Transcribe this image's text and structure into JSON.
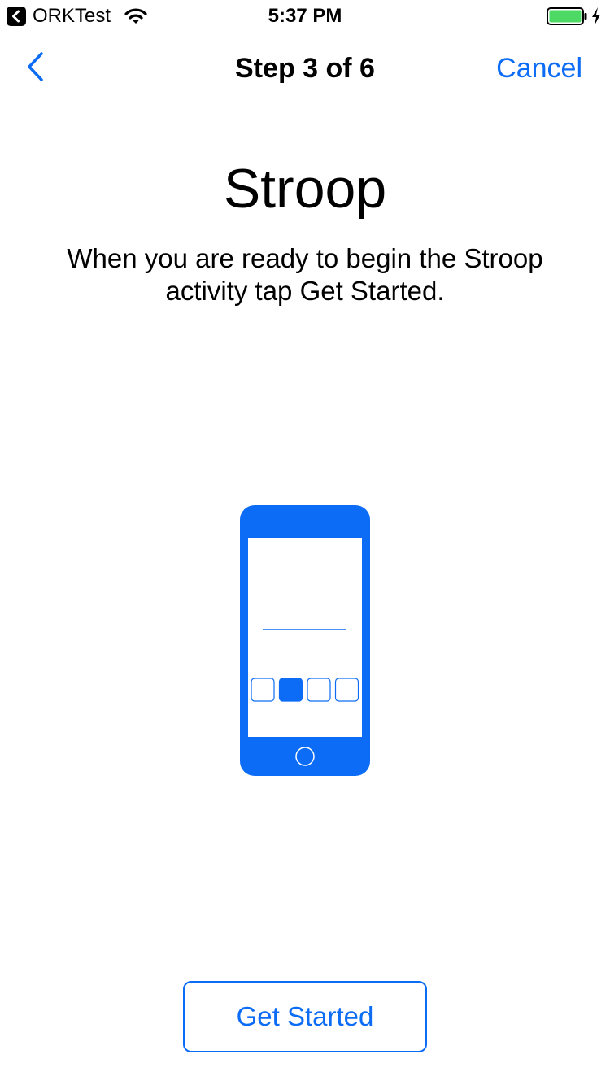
{
  "status_bar": {
    "back_app_label": "ORKTest",
    "time": "5:37 PM",
    "battery_level": 1.0,
    "charging": true
  },
  "nav": {
    "title": "Step 3 of 6",
    "cancel_label": "Cancel",
    "back_icon": "chevron-left-icon"
  },
  "content": {
    "title": "Stroop",
    "text": "When you are ready to begin the Stroop activity tap Get Started.",
    "illustration": "phone-stroop-illustration",
    "selected_box": 2,
    "box_count": 4
  },
  "footer": {
    "button_label": "Get Started"
  },
  "colors": {
    "accent": "#0c6cf5",
    "battery": "#4cd964"
  }
}
